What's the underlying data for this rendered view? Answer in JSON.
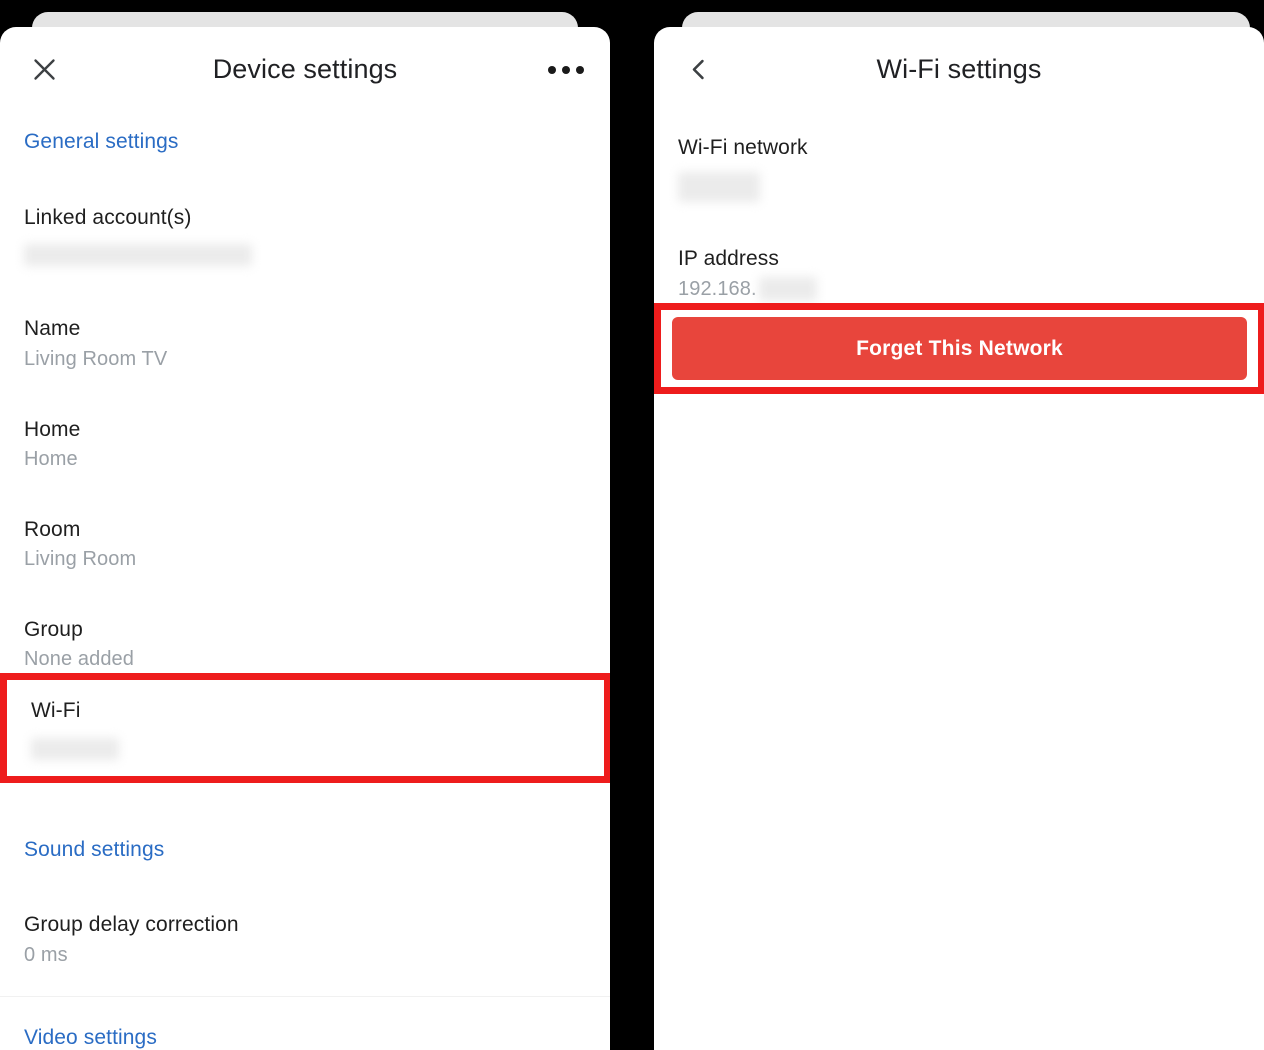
{
  "theme": {
    "background": "#000000",
    "sheet": "#ffffff",
    "peek_card": "#e4e4e4",
    "link_blue": "#2a6cc4",
    "label_black": "#1f1f1f",
    "value_grey": "#9aa0a6",
    "annotation_red": "#ee1c1c",
    "danger_button_red": "#e8453c",
    "divider": "#f1f1f1",
    "redaction_grey": "#ebebeb"
  },
  "left_panel": {
    "header": {
      "close_icon": "close-icon",
      "title": "Device settings",
      "overflow_icon": "more-options-icon"
    },
    "sections": [
      {
        "heading": "General settings",
        "rows": [
          {
            "label": "Linked account(s)",
            "value": "",
            "redacted": true,
            "redact_width": 228,
            "redact_height": 22
          },
          {
            "label": "Name",
            "value": "Living Room TV",
            "redacted": false
          },
          {
            "label": "Home",
            "value": "Home",
            "redacted": false
          },
          {
            "label": "Room",
            "value": "Living Room",
            "redacted": false
          },
          {
            "label": "Group",
            "value": "None added",
            "redacted": false
          }
        ],
        "highlighted_row": {
          "label": "Wi-Fi",
          "value": "",
          "redacted": true,
          "redact_width": 88,
          "redact_height": 22
        }
      },
      {
        "heading": "Sound settings",
        "rows": [
          {
            "label": "Group delay correction",
            "value": "0 ms",
            "redacted": false
          }
        ]
      },
      {
        "heading": "Video settings",
        "rows": []
      }
    ]
  },
  "right_panel": {
    "header": {
      "back_icon": "back-chevron-icon",
      "title": "Wi-Fi settings"
    },
    "rows": [
      {
        "label": "Wi-Fi network",
        "value": "",
        "redacted": true,
        "redact_width": 82,
        "redact_height": 30
      },
      {
        "label": "IP address",
        "value": "192.168.",
        "redacted": true,
        "redact_width": 58,
        "redact_height": 24
      }
    ],
    "danger_button": {
      "label": "Forget This Network"
    }
  }
}
